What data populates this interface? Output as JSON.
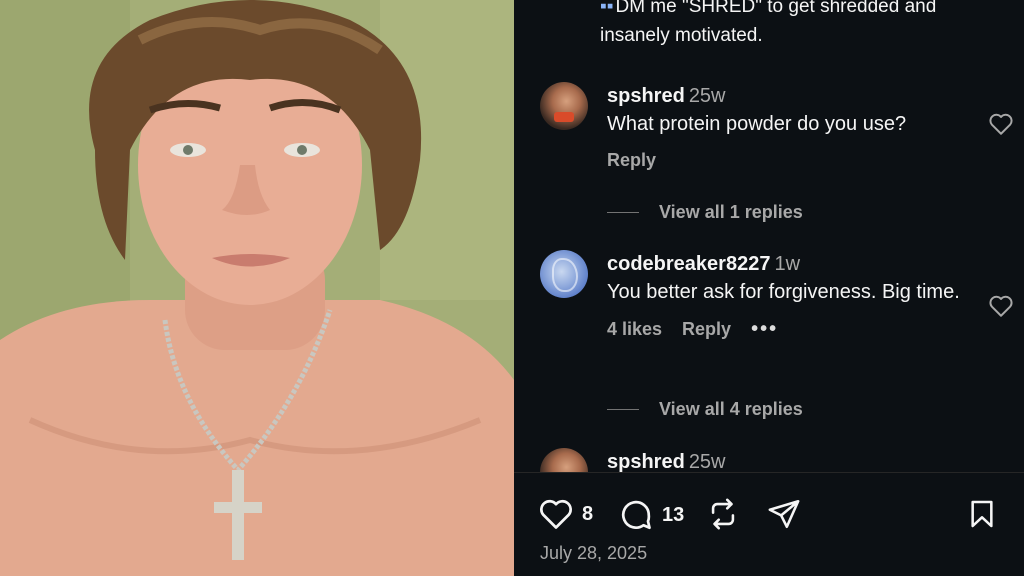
{
  "post": {
    "caption_line1": "DM me \"SHRED\" to get shredded and",
    "caption_line2": "insanely motivated.",
    "date": "July 28, 2025"
  },
  "comments": [
    {
      "username": "spshred",
      "ago": "25w",
      "text": "What protein powder do you use?",
      "reply_label": "Reply",
      "view_replies": "View all 1 replies"
    },
    {
      "username": "codebreaker8227",
      "ago": "1w",
      "text": "You better ask for forgiveness. Big time.",
      "likes": "4 likes",
      "reply_label": "Reply",
      "more": "•••",
      "view_replies": "View all 4 replies"
    },
    {
      "username": "spshred",
      "ago": "25w"
    }
  ],
  "actions": {
    "like_count": "8",
    "comment_count": "13"
  },
  "icons": {
    "like": "heart-icon",
    "comment": "comment-bubble-icon",
    "repost": "repost-icon",
    "share": "paper-plane-icon",
    "save": "bookmark-icon"
  },
  "colors": {
    "background": "#0c1014",
    "text": "#f5f5f5",
    "secondary": "#a8a8a8"
  }
}
